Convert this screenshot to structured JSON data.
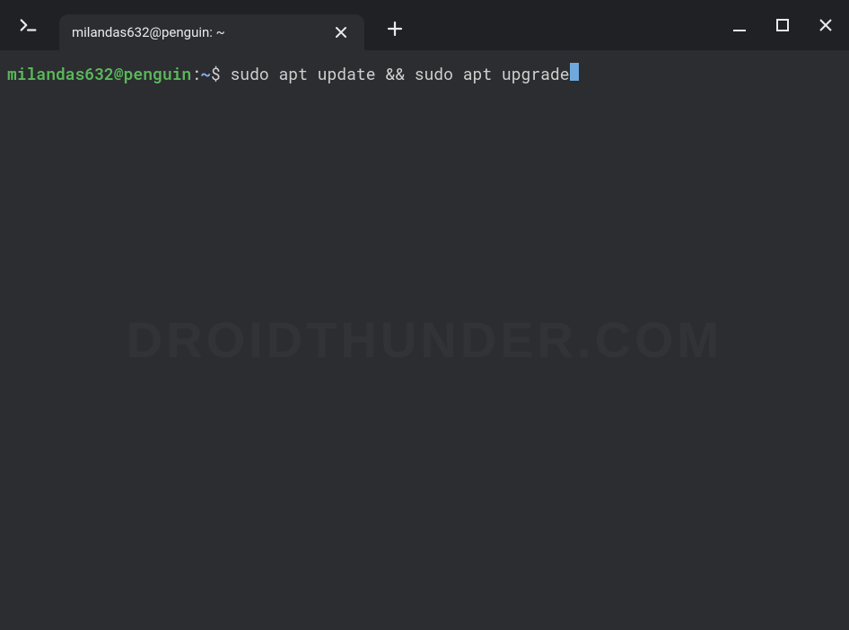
{
  "titlebar": {
    "tab_title": "milandas632@penguin: ~",
    "app_icon_name": "terminal-icon",
    "close_tab_label": "close",
    "new_tab_label": "new tab",
    "minimize_label": "minimize",
    "maximize_label": "maximize",
    "close_label": "close"
  },
  "terminal": {
    "prompt": {
      "user_host": "milandas632@penguin",
      "separator": ":",
      "path": "~",
      "symbol": "$ "
    },
    "command": "sudo apt update && sudo apt upgrade"
  },
  "watermark": "DROIDTHUNDER.COM",
  "colors": {
    "bg_outer": "#202124",
    "bg_terminal": "#2B2D30",
    "prompt_user": "#5cb85c",
    "prompt_path": "#8aadf4",
    "cursor": "#6fa8dc",
    "text": "#d0d0d0"
  }
}
